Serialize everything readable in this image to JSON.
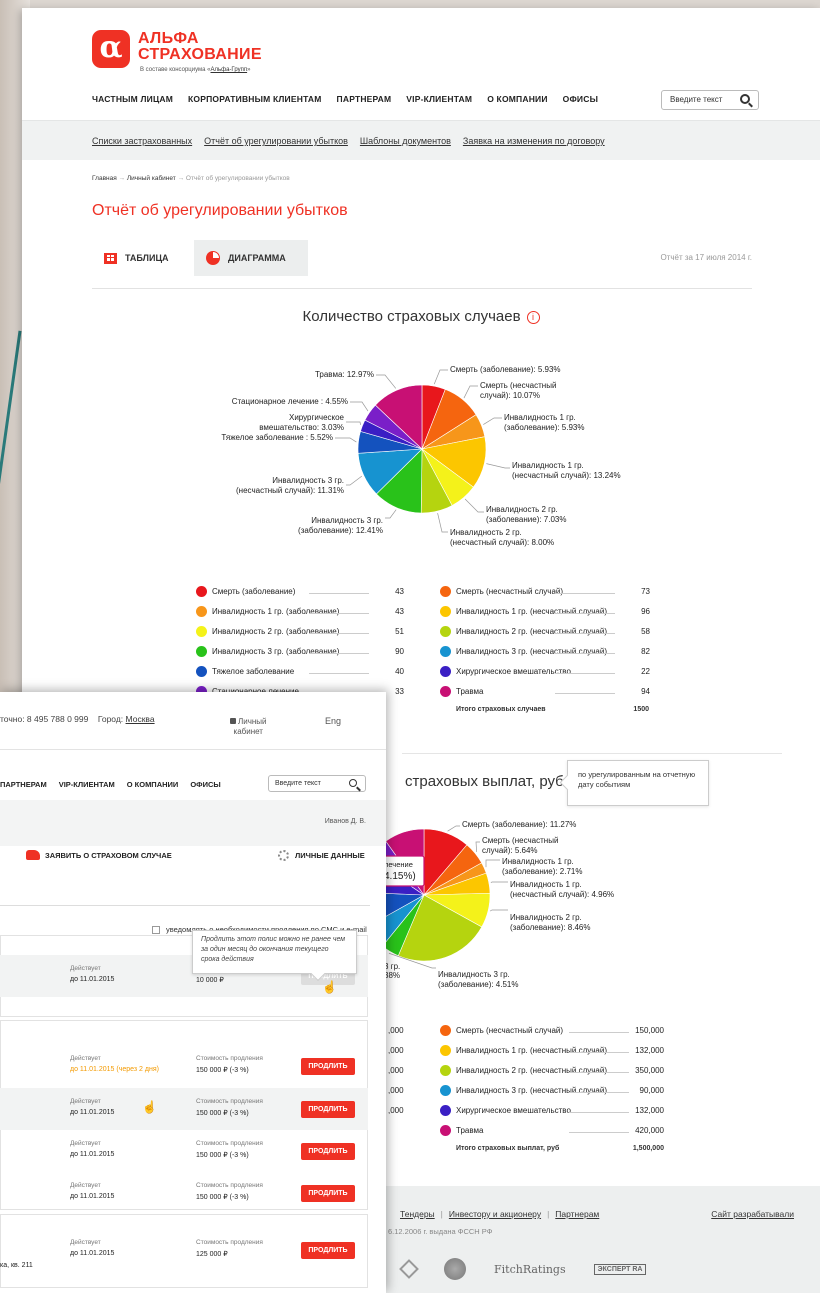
{
  "logo": {
    "mark": "α",
    "line1": "АЛЬФА",
    "line2": "СТРАХОВАНИЕ",
    "tag_pre": "В составе консорциума «",
    "tag_link": "Альфа-Групп",
    "tag_post": "»"
  },
  "nav": [
    "ЧАСТНЫМ ЛИЦАМ",
    "КОРПОРАТИВНЫМ КЛИЕНТАМ",
    "ПАРТНЕРАМ",
    "VIP-КЛИЕНТАМ",
    "О КОМПАНИИ",
    "ОФИСЫ"
  ],
  "search": {
    "placeholder": "Введите текст"
  },
  "subnav": [
    "Списки застрахованных",
    "Отчёт об урегулировании убытков",
    "Шаблоны документов",
    "Заявка на изменения по договору"
  ],
  "breadcrumb": {
    "home": "Главная",
    "arrow": " → ",
    "cabinet": "Личный кабинет",
    "current": "Отчёт об урегулировании убытков"
  },
  "page_title": "Отчёт об урегулировании убытков",
  "tabs": {
    "table": "ТАБЛИЦА",
    "chart": "ДИАГРАММА"
  },
  "report_date": "Отчёт за 17 июля 2014 г.",
  "info_glyph": "i",
  "chart_data": [
    {
      "type": "pie",
      "title": "Количество страховых случаев",
      "slices": [
        {
          "label": "Смерть (заболевание)",
          "callout": [
            "Смерть (заболевание): 5.93%"
          ],
          "pct": 5.93,
          "color": "#e8171c"
        },
        {
          "label": "Смерть (несчастный случай)",
          "callout": [
            "Смерть (несчастный",
            "случай): 10.07%"
          ],
          "pct": 10.07,
          "color": "#f5650f"
        },
        {
          "label": "Инвалидность 1 гр. (заболевание)",
          "callout": [
            "Инвалидность 1 гр.",
            "(заболевание): 5.93%"
          ],
          "pct": 5.93,
          "color": "#f7961a"
        },
        {
          "label": "Инвалидность 1 гр. (несчастный случай)",
          "callout": [
            "Инвалидность 1 гр.",
            "(несчастный случай): 13.24%"
          ],
          "pct": 13.24,
          "color": "#fcc600"
        },
        {
          "label": "Инвалидность 2 гр. (заболевание)",
          "callout": [
            "Инвалидность 2 гр.",
            "(заболевание): 7.03%"
          ],
          "pct": 7.03,
          "color": "#f4f21a"
        },
        {
          "label": "Инвалидность 2 гр. (несчастный случай)",
          "callout": [
            "Инвалидность 2 гр.",
            "(несчастный случай): 8.00%"
          ],
          "pct": 8.0,
          "color": "#b5d40f"
        },
        {
          "label": "Инвалидность 3 гр. (заболевание)",
          "callout": [
            "Инвалидность 3 гр.",
            "(заболевание): 12.41%"
          ],
          "pct": 12.41,
          "color": "#29c21a"
        },
        {
          "label": "Инвалидность 3 гр. (несчастный случай)",
          "callout": [
            "Инвалидность 3 гр.",
            "(несчастный случай): 11.31%"
          ],
          "pct": 11.31,
          "color": "#1793d0"
        },
        {
          "label": "Тяжелое заболевание",
          "callout": [
            "Тяжелое заболевание : 5.52%"
          ],
          "pct": 5.52,
          "color": "#1452be"
        },
        {
          "label": "Хирургическое вмешательство",
          "callout": [
            "Хирургическое",
            "вмешательство: 3.03%"
          ],
          "pct": 3.03,
          "color": "#3a1fc4"
        },
        {
          "label": "Стационарное лечение",
          "callout": [
            "Стационарное лечение : 4.55%"
          ],
          "pct": 4.55,
          "color": "#7a1fc8"
        },
        {
          "label": "Травма",
          "callout": [
            "Травма: 12.97%"
          ],
          "pct": 12.97,
          "color": "#c81074"
        }
      ],
      "legend_left": [
        {
          "label": "Смерть (заболевание)",
          "value": "43",
          "color": "#e8171c"
        },
        {
          "label": "Инвалидность 1 гр. (заболевание)",
          "value": "43",
          "color": "#f7961a"
        },
        {
          "label": "Инвалидность 2 гр. (заболевание)",
          "value": "51",
          "color": "#f4f21a"
        },
        {
          "label": "Инвалидность 3 гр. (заболевание)",
          "value": "90",
          "color": "#29c21a"
        },
        {
          "label": "Тяжелое заболевание",
          "value": "40",
          "color": "#1452be"
        },
        {
          "label": "Стационарное лечение",
          "value": "33",
          "color": "#7a1fc8"
        }
      ],
      "legend_right": [
        {
          "label": "Смерть (несчастный случай)",
          "value": "73",
          "color": "#f5650f"
        },
        {
          "label": "Инвалидность 1 гр. (несчастный случай)",
          "value": "96",
          "color": "#fcc600"
        },
        {
          "label": "Инвалидность 2 гр. (несчастный случай)",
          "value": "58",
          "color": "#b5d40f"
        },
        {
          "label": "Инвалидность 3 гр. (несчастный случай)",
          "value": "82",
          "color": "#1793d0"
        },
        {
          "label": "Хирургическое вмешательство",
          "value": "22",
          "color": "#3a1fc4"
        },
        {
          "label": "Травма",
          "value": "94",
          "color": "#c81074"
        }
      ],
      "total_label": "Итого страховых случаев",
      "total_value": "1500"
    },
    {
      "type": "pie",
      "title": "страховых выплат, руб",
      "slices": [
        {
          "label": "Смерть (заболевание)",
          "callout": [
            "Смерть (заболевание): 11.27%"
          ],
          "pct": 11.27,
          "color": "#e8171c"
        },
        {
          "label": "Смерть (несчастный случай)",
          "callout": [
            "Смерть (несчастный",
            "случай): 5.64%"
          ],
          "pct": 5.64,
          "color": "#f5650f"
        },
        {
          "label": "Инвалидность 1 гр. (заболевание)",
          "callout": [
            "Инвалидность 1 гр.",
            "(заболевание): 2.71%"
          ],
          "pct": 2.71,
          "color": "#f7961a"
        },
        {
          "label": "Инвалидность 1 гр. (несчастный случай)",
          "callout": [
            "Инвалидность 1 гр.",
            "(несчастный случай): 4.96%"
          ],
          "pct": 4.96,
          "color": "#fcc600"
        },
        {
          "label": "Инвалидность 2 гр. (заболевание)",
          "callout": [
            "Инвалидность 2 гр.",
            "(заболевание): 8.46%"
          ],
          "pct": 8.46,
          "color": "#f4f21a"
        },
        {
          "label": "Инвалидность 2 гр. (несчастный случай)",
          "callout": [],
          "pct": 23.33,
          "color": "#b5d40f"
        },
        {
          "label": "Инвалидность 3 гр. (заболевание)",
          "callout": [
            "Инвалидность 3 гр.",
            "(заболевание): 4.51%"
          ],
          "pct": 4.51,
          "color": "#29c21a"
        },
        {
          "label": "Инвалидность 3 гр. (несчастный случай)",
          "callout": [],
          "pct": 6.0,
          "color": "#1793d0"
        },
        {
          "label": "Тяжелое заболевание",
          "callout": [],
          "pct": 8.8,
          "color": "#1452be"
        },
        {
          "label": "Хирургическое вмешательство",
          "callout": [],
          "pct": 8.8,
          "color": "#3a1fc4"
        },
        {
          "label": "Стационарное лечение",
          "callout": [],
          "pct": 5.7,
          "color": "#7a1fc8"
        },
        {
          "label": "Травма",
          "callout": [],
          "pct": 9.82,
          "color": "#c81074"
        }
      ],
      "legend_left_values": [
        ",000",
        ",000",
        ",000",
        ",000",
        ",000"
      ],
      "legend_right": [
        {
          "label": "Смерть (несчастный случай)",
          "value": "150,000",
          "color": "#f5650f"
        },
        {
          "label": "Инвалидность 1 гр. (несчастный случай)",
          "value": "132,000",
          "color": "#fcc600"
        },
        {
          "label": "Инвалидность 2 гр. (несчастный случай)",
          "value": "350,000",
          "color": "#b5d40f"
        },
        {
          "label": "Инвалидность 3 гр. (несчастный случай)",
          "value": "90,000",
          "color": "#1793d0"
        },
        {
          "label": "Хирургическое вмешательство",
          "value": "132,000",
          "color": "#3a1fc4"
        },
        {
          "label": "Травма",
          "value": "420,000",
          "color": "#c81074"
        }
      ],
      "total_label": "Итого страховых выплат, руб",
      "total_value": "1,500,000",
      "partial_labels": {
        "hover_1": "лечение",
        "hover_2": "4.15%)",
        "left_1": "3 гр.",
        "left_2": "38%"
      },
      "tooltip": "по урегулированным на отчетную дату событиям"
    }
  ],
  "footer": {
    "links": [
      "Тендеры",
      "Инвестору и акционеру",
      "Партнерам"
    ],
    "developer": "Сайт разрабатывали",
    "license": "6.12.2006 г. выдана ФССН РФ",
    "logos": [
      "FitchRatings",
      "ЭКСПЕРТ RA"
    ]
  },
  "front": {
    "phone": "точно: 8 495 788 0 999",
    "city_label": "Город:",
    "city": "Москва",
    "cabinet_1": "Личный",
    "cabinet_2": "кабинет",
    "lang": "Eng",
    "nav": [
      "ПАРТНЕРАМ",
      "VIP-КЛИЕНТАМ",
      "О КОМПАНИИ",
      "ОФИСЫ"
    ],
    "search_placeholder": "Введите текст",
    "user": "Иванов Д. В.",
    "claim": "ЗАЯВИТЬ О СТРАХОВОМ СЛУЧАЕ",
    "personal": "ЛИЧНЫЕ ДАННЫЕ",
    "notify": "уведомлять о необходимости продления по СМС и e-mail",
    "tip": "Продлить этот полис можно не ранее чем за один месяц до окончания текущего срока действия",
    "rows": [
      {
        "l1": "Действует",
        "v1": "до 11.01.2015",
        "l2": "Стоимость полиса",
        "v2": "10 000 ₽",
        "btn": "ПРОДЛИТЬ",
        "disabled": true,
        "orange": false,
        "gray": true
      },
      {
        "l1": "Действует",
        "v1": "до 11.01.2015 (через 2 дня)",
        "l2": "Стоимость продления",
        "v2": "150 000 ₽  (-3 %)",
        "btn": "ПРОДЛИТЬ",
        "disabled": false,
        "orange": true,
        "gray": false
      },
      {
        "l1": "Действует",
        "v1": "до 11.01.2015",
        "l2": "Стоимость продления",
        "v2": "150 000 ₽  (-3 %)",
        "btn": "ПРОДЛИТЬ",
        "disabled": false,
        "orange": false,
        "gray": true
      },
      {
        "l1": "Действует",
        "v1": "до 11.01.2015",
        "l2": "Стоимость продления",
        "v2": "150 000 ₽  (-3 %)",
        "btn": "ПРОДЛИТЬ",
        "disabled": false,
        "orange": false,
        "gray": false
      },
      {
        "l1": "Действует",
        "v1": "до 11.01.2015",
        "l2": "Стоимость продления",
        "v2": "150 000 ₽  (-3 %)",
        "btn": "ПРОДЛИТЬ",
        "disabled": false,
        "orange": false,
        "gray": false
      },
      {
        "l1": "Действует",
        "v1": "до 11.01.2015",
        "l2": "Стоимость продления",
        "v2": "125 000 ₽",
        "btn": "ПРОДЛИТЬ",
        "disabled": false,
        "orange": false,
        "gray": false
      }
    ],
    "address": "ка, кв. 211"
  }
}
